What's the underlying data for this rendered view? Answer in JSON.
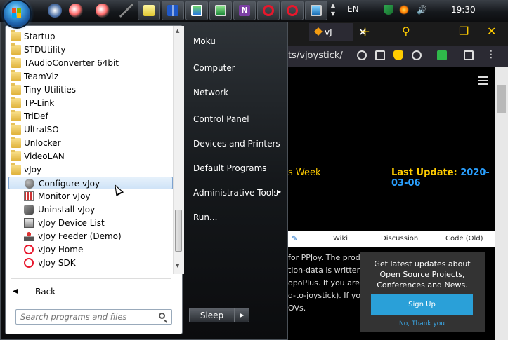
{
  "taskbar": {
    "language": "EN",
    "clock": "19:30"
  },
  "browser": {
    "tab_title": "vJ",
    "address_fragment": "ts/vjoystick/",
    "page": {
      "week_text": "s Week",
      "last_update_label": "Last Update:",
      "last_update_value": "2020-03-06",
      "nav": [
        "Wiki",
        "Discussion",
        "Code (Old)"
      ],
      "body_lines": [
        "for PPJoy. The prod",
        "tion-data is written t",
        "opoPlus. If you are an",
        "d-to-joystick). If you a",
        "OVs."
      ],
      "promo_heading": "Get latest updates about Open Source Projects, Conferences and News.",
      "promo_signup": "Sign Up",
      "promo_decline": "No, Thank you"
    }
  },
  "start_menu": {
    "programs": [
      {
        "label": "Startup",
        "icon": "folder-icon",
        "level": 0
      },
      {
        "label": "STDUtility",
        "icon": "folder-icon",
        "level": 0
      },
      {
        "label": "TAudioConverter 64bit",
        "icon": "folder-icon",
        "level": 0
      },
      {
        "label": "TeamViz",
        "icon": "folder-icon",
        "level": 0
      },
      {
        "label": "Tiny Utilities",
        "icon": "folder-icon",
        "level": 0
      },
      {
        "label": "TP-Link",
        "icon": "folder-icon",
        "level": 0
      },
      {
        "label": "TriDef",
        "icon": "folder-icon",
        "level": 0
      },
      {
        "label": "UltraISO",
        "icon": "folder-icon",
        "level": 0
      },
      {
        "label": "Unlocker",
        "icon": "folder-icon",
        "level": 0
      },
      {
        "label": "VideoLAN",
        "icon": "folder-icon",
        "level": 0
      },
      {
        "label": "vJoy",
        "icon": "folder-icon",
        "level": 0
      },
      {
        "label": "Configure vJoy",
        "icon": "configure-icon",
        "level": 1,
        "selected": true
      },
      {
        "label": "Monitor vJoy",
        "icon": "monitor-icon",
        "level": 1
      },
      {
        "label": "Uninstall vJoy",
        "icon": "uninstall-icon",
        "level": 1
      },
      {
        "label": "vJoy Device List",
        "icon": "device-list-icon",
        "level": 1
      },
      {
        "label": "vJoy Feeder (Demo)",
        "icon": "joystick-icon",
        "level": 1
      },
      {
        "label": "vJoy Home",
        "icon": "opera-icon",
        "level": 1
      },
      {
        "label": "vJoy SDK",
        "icon": "opera-icon",
        "level": 1
      }
    ],
    "back_label": "Back",
    "search_placeholder": "Search programs and files",
    "right_items": [
      "Moku",
      "Computer",
      "Network",
      "Control Panel",
      "Devices and Printers",
      "Default Programs",
      "Administrative Tools",
      "Run..."
    ],
    "sleep_label": "Sleep"
  }
}
